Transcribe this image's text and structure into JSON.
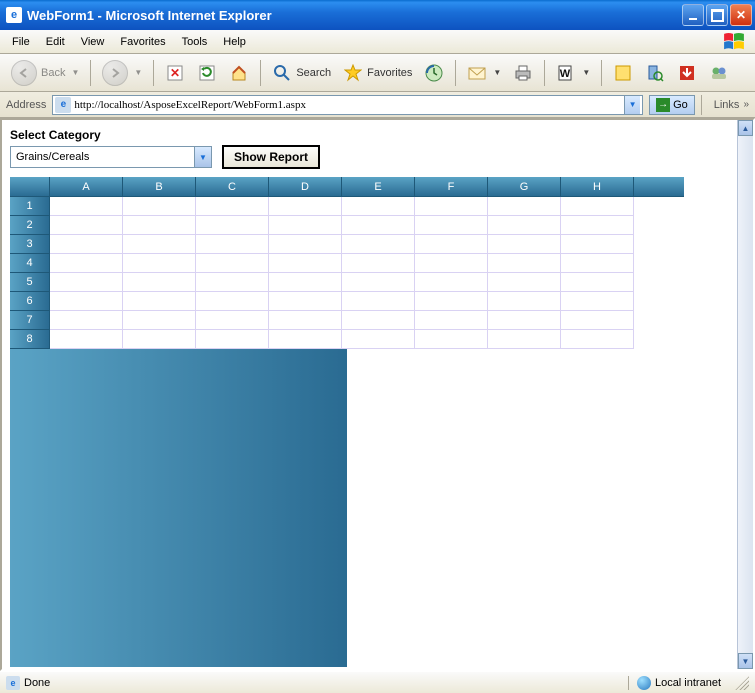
{
  "window": {
    "title": "WebForm1 - Microsoft Internet Explorer"
  },
  "menu": {
    "items": [
      "File",
      "Edit",
      "View",
      "Favorites",
      "Tools",
      "Help"
    ]
  },
  "toolbar": {
    "back_label": "Back",
    "search_label": "Search",
    "favorites_label": "Favorites"
  },
  "addressbar": {
    "label": "Address",
    "url": "http://localhost/AsposeExcelReport/WebForm1.aspx",
    "go_label": "Go",
    "links_label": "Links"
  },
  "page": {
    "category_label": "Select Category",
    "category_value": "Grains/Cereals",
    "show_report_label": "Show Report",
    "columns": [
      "A",
      "B",
      "C",
      "D",
      "E",
      "F",
      "G",
      "H"
    ],
    "rows": [
      "1",
      "2",
      "3",
      "4",
      "5",
      "6",
      "7",
      "8"
    ]
  },
  "status": {
    "text": "Done",
    "zone": "Local intranet"
  }
}
